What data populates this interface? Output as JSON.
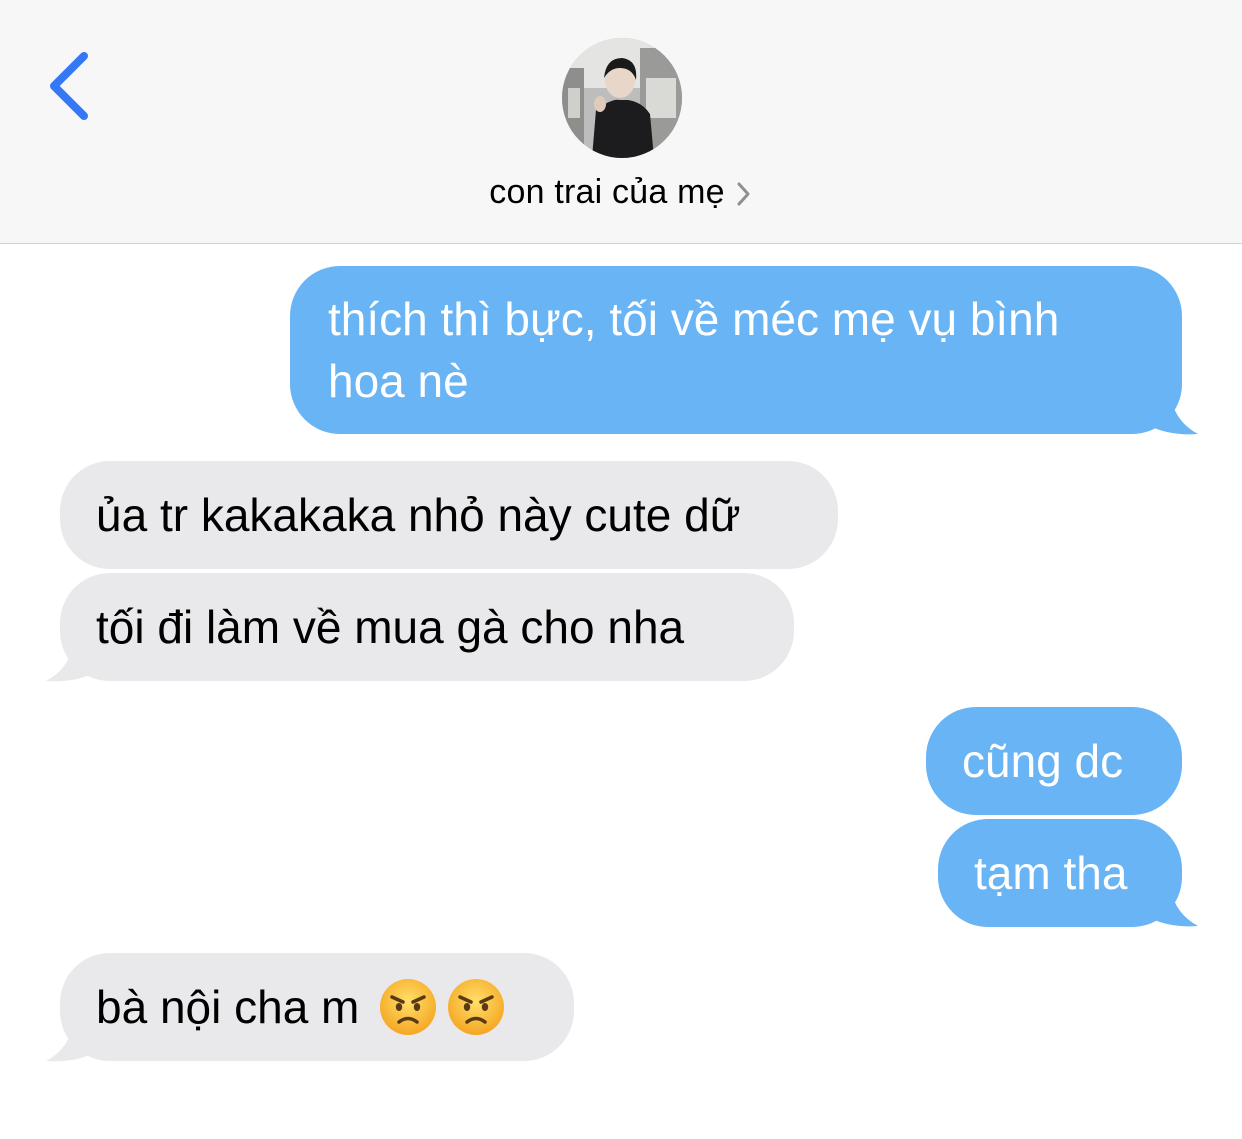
{
  "header": {
    "contact_name": "con trai của mẹ",
    "back_icon": "chevron-left-icon",
    "details_icon": "chevron-right-icon",
    "accent_color": "#3478f6"
  },
  "messages": [
    {
      "direction": "sent",
      "text_line1": "thích thì bực, tối về méc mẹ vụ bình",
      "text_line2": "hoa nè"
    },
    {
      "direction": "received",
      "text": "ủa tr kakakaka nhỏ này cute dữ"
    },
    {
      "direction": "received",
      "text": "tối đi làm về mua gà cho nha"
    },
    {
      "direction": "sent",
      "text": "cũng dc"
    },
    {
      "direction": "sent",
      "text": "tạm tha"
    },
    {
      "direction": "received",
      "text": "bà nội cha m",
      "emojis": [
        "angry-face-icon",
        "angry-face-icon"
      ]
    }
  ],
  "colors": {
    "sent_bubble": "#68b4f4",
    "received_bubble": "#e9e9eb"
  }
}
